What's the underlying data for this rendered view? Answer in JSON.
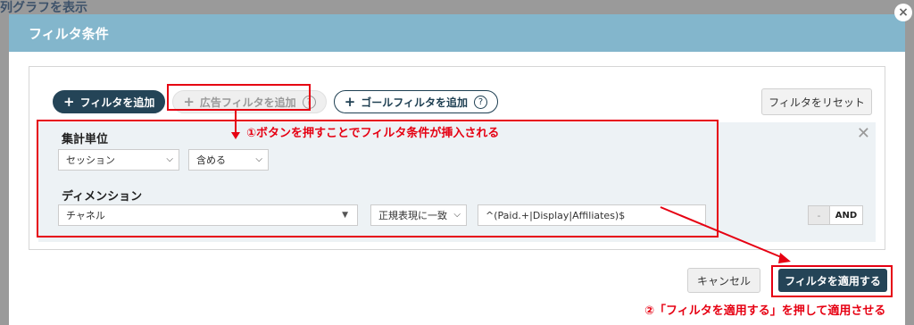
{
  "background": {
    "title": "列グラフを表示",
    "close_glyph": "×"
  },
  "modal": {
    "title": "フィルタ条件"
  },
  "toolbar": {
    "add_filter": "フィルタを追加",
    "add_ad_filter": "広告フィルタを追加",
    "add_goal_filter": "ゴールフィルタを追加",
    "help_glyph": "?",
    "plus_glyph": "+",
    "reset": "フィルタをリセット"
  },
  "condition": {
    "close_glyph": "✕",
    "unit_label": "集計単位",
    "unit_select": "セッション",
    "match_select": "含める",
    "dimension_label": "ディメンション",
    "dimension_select": "チャネル",
    "operator_select": "正規表現に一致",
    "value": "^(Paid.+|Display|Affiliates)$",
    "minus": "-",
    "and": "AND"
  },
  "footer": {
    "cancel": "キャンセル",
    "apply": "フィルタを適用する"
  },
  "annotations": {
    "note1": "①ボタンを押すことでフィルタ条件が挿入される",
    "note2": "②「フィルタを適用する」を押して適用させる"
  },
  "colors": {
    "header": "#83b6cc",
    "primary": "#244457",
    "annotation": "#e60012"
  }
}
